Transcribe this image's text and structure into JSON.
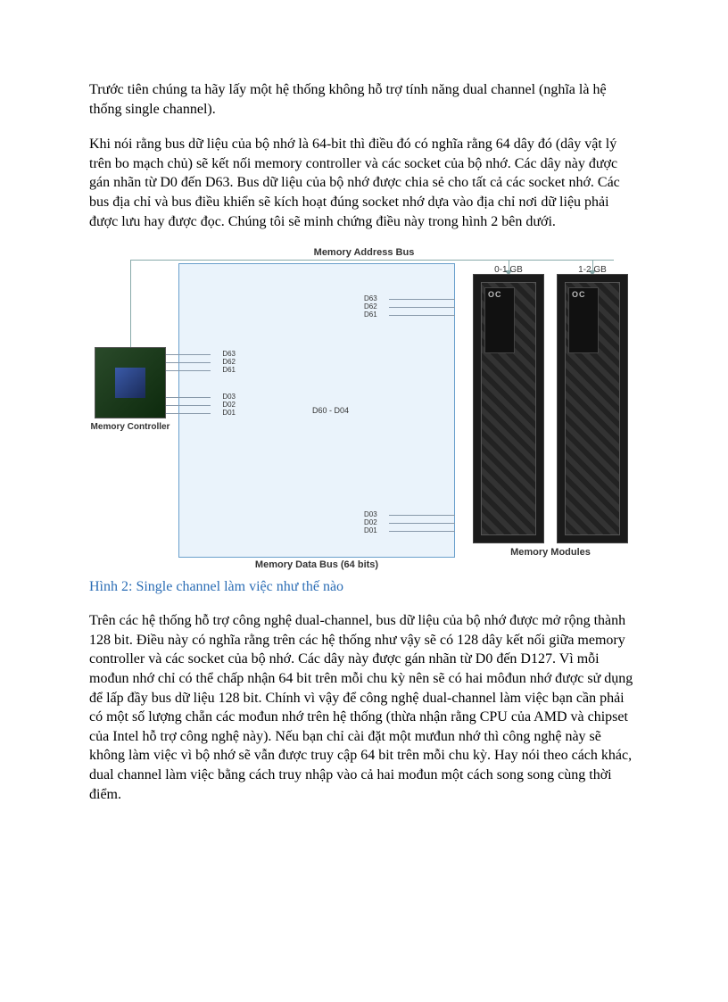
{
  "paragraphs": {
    "p1": "Trước tiên chúng ta hãy lấy một hệ thống không hỗ trợ tính năng dual channel (nghĩa là hệ thống single channel).",
    "p2": "Khi nói rằng bus dữ liệu của bộ nhớ là 64-bit thì điều đó có nghĩa rằng 64 dây đó (dây vật lý trên bo mạch chủ) sẽ kết nối memory controller và các socket của bộ nhớ. Các dây này được gán nhãn từ D0 đến D63. Bus dữ liệu của bộ nhớ được chia sẻ cho tất cả các socket nhớ. Các bus địa chỉ và bus điều khiển sẽ kích hoạt đúng socket nhớ dựa vào địa chỉ nơi dữ liệu phải được lưu hay được đọc. Chúng tôi sẽ minh chứng điều này trong hình 2 bên dưới.",
    "p3": "Trên các hệ thống hỗ trợ công nghệ dual-channel, bus dữ liệu của bộ nhớ được mở rộng thành 128 bit. Điều này có nghĩa rằng trên các hệ thống như vậy sẽ có 128 dây kết nối giữa memory controller và các socket của bộ nhớ. Các dây này được gán nhãn từ D0 đến D127. Vì mỗi mođun nhớ chỉ có thể chấp nhận 64 bit trên mỗi chu kỳ nên sẽ có hai môđun nhớ được sử dụng để lấp đầy bus dữ liệu 128 bit. Chính vì vậy để công nghệ dual-channel làm việc bạn cần phải có một số lượng chẵn các mođun nhớ trên hệ thống (thừa nhận rằng CPU của AMD và chipset của Intel hỗ trợ công nghệ này). Nếu bạn chỉ cài đặt một mưđun nhớ thì công nghệ này sẽ không làm việc vì bộ nhớ sẽ vẫn được truy cập 64 bit trên mỗi chu kỳ. Hay nói theo cách khác, dual channel làm việc bằng cách truy nhập vào cả hai mođun một cách song song cùng thời điểm."
  },
  "caption": "Hình 2: Single channel làm việc như thế nào",
  "diagram": {
    "address_bus_label": "Memory Address Bus",
    "data_bus_label": "Memory Data Bus (64 bits)",
    "memory_controller_label": "Memory Controller",
    "memory_modules_label": "Memory Modules",
    "ram_range_1": "0-1 GB",
    "ram_range_2": "1-2 GB",
    "mid_range_label": "D60 - D04",
    "lines_left_top": [
      "D63",
      "D62",
      "D61"
    ],
    "lines_left_bot": [
      "D03",
      "D02",
      "D01"
    ],
    "lines_right_top": [
      "D63",
      "D62",
      "D61"
    ],
    "lines_right_bot": [
      "D03",
      "D02",
      "D01"
    ]
  }
}
